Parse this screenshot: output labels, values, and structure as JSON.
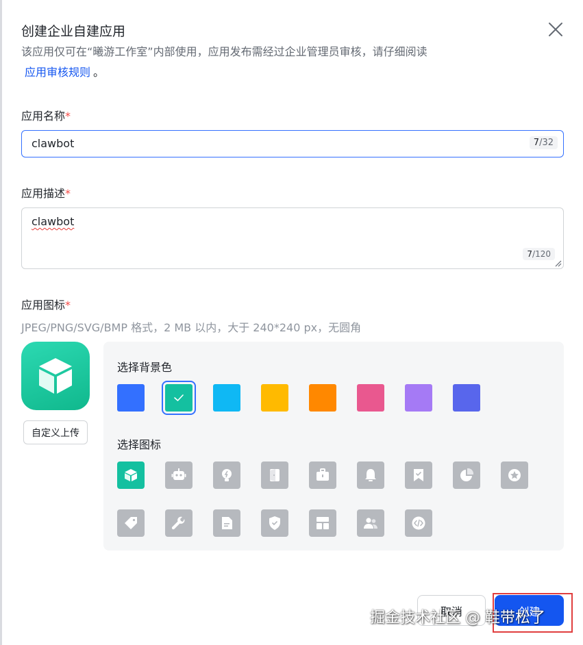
{
  "dialog": {
    "title": "创建企业自建应用",
    "description": "该应用仅可在“曦游工作室”内部使用，应用发布需经过企业管理员审核，请仔细阅读",
    "rules_link": "应用审核规则",
    "rules_suffix": "。"
  },
  "form": {
    "name": {
      "label": "应用名称",
      "required_mark": "*",
      "value": "clawbot",
      "count": "7",
      "max": "/32"
    },
    "description": {
      "label": "应用描述",
      "required_mark": "*",
      "value": "clawbot",
      "count": "7",
      "max": "/120"
    },
    "icon": {
      "label": "应用图标",
      "required_mark": "*",
      "hint": "JPEG/PNG/SVG/BMP 格式，2 MB 以内，大于 240*240 px，无圆角",
      "upload_label": "自定义上传",
      "bg_title": "选择背景色",
      "icon_title": "选择图标",
      "colors": [
        {
          "name": "blue",
          "hex": "#3370ff"
        },
        {
          "name": "teal",
          "hex": "#14c0a0",
          "selected": true
        },
        {
          "name": "cyan",
          "hex": "#0fb8f4"
        },
        {
          "name": "yellow",
          "hex": "#ffba00"
        },
        {
          "name": "orange",
          "hex": "#ff8800"
        },
        {
          "name": "pink",
          "hex": "#e9588f"
        },
        {
          "name": "purple",
          "hex": "#a57af5"
        },
        {
          "name": "indigo",
          "hex": "#5866ec"
        }
      ],
      "icons": [
        "cube-icon",
        "robot-icon",
        "lightbulb-icon",
        "door-icon",
        "briefcase-icon",
        "bell-icon",
        "bookmark-check-icon",
        "pie-chart-icon",
        "star-badge-icon",
        "tag-icon",
        "wrench-icon",
        "document-icon",
        "shield-check-icon",
        "layout-icon",
        "team-icon",
        "code-icon"
      ]
    }
  },
  "footer": {
    "cancel_label": "取消",
    "create_label": "创建"
  },
  "watermark": "掘金技术社区 @ 鞋带松了",
  "colors": {
    "primary": "#1456f0",
    "required": "#f54a45",
    "icon_inactive": "#b6b9be",
    "icon_active": "#14c0a0"
  }
}
